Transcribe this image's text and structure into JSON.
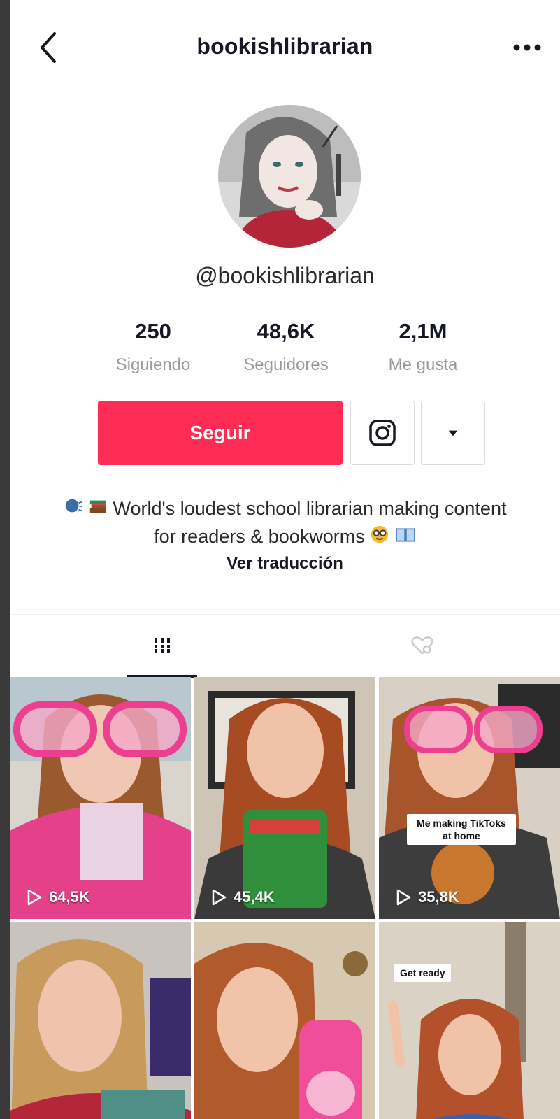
{
  "header": {
    "title": "bookishlibrarian"
  },
  "profile": {
    "handle": "@bookishlibrarian",
    "stats": [
      {
        "value": "250",
        "label": "Siguiendo"
      },
      {
        "value": "48,6K",
        "label": "Seguidores"
      },
      {
        "value": "2,1M",
        "label": "Me gusta"
      }
    ],
    "follow_label": "Seguir",
    "bio_text": "World's loudest school librarian making content for readers & bookworms",
    "translate_label": "Ver traducción"
  },
  "colors": {
    "accent": "#fe2c55"
  },
  "videos": [
    {
      "views": "64,5K",
      "caption": ""
    },
    {
      "views": "45,4K",
      "caption": ""
    },
    {
      "views": "35,8K",
      "caption_line1": "Me making TikToks",
      "caption_line2": "at home"
    },
    {
      "views": "",
      "caption": ""
    },
    {
      "views": "",
      "caption": ""
    },
    {
      "views": "",
      "caption": "Get ready"
    }
  ]
}
